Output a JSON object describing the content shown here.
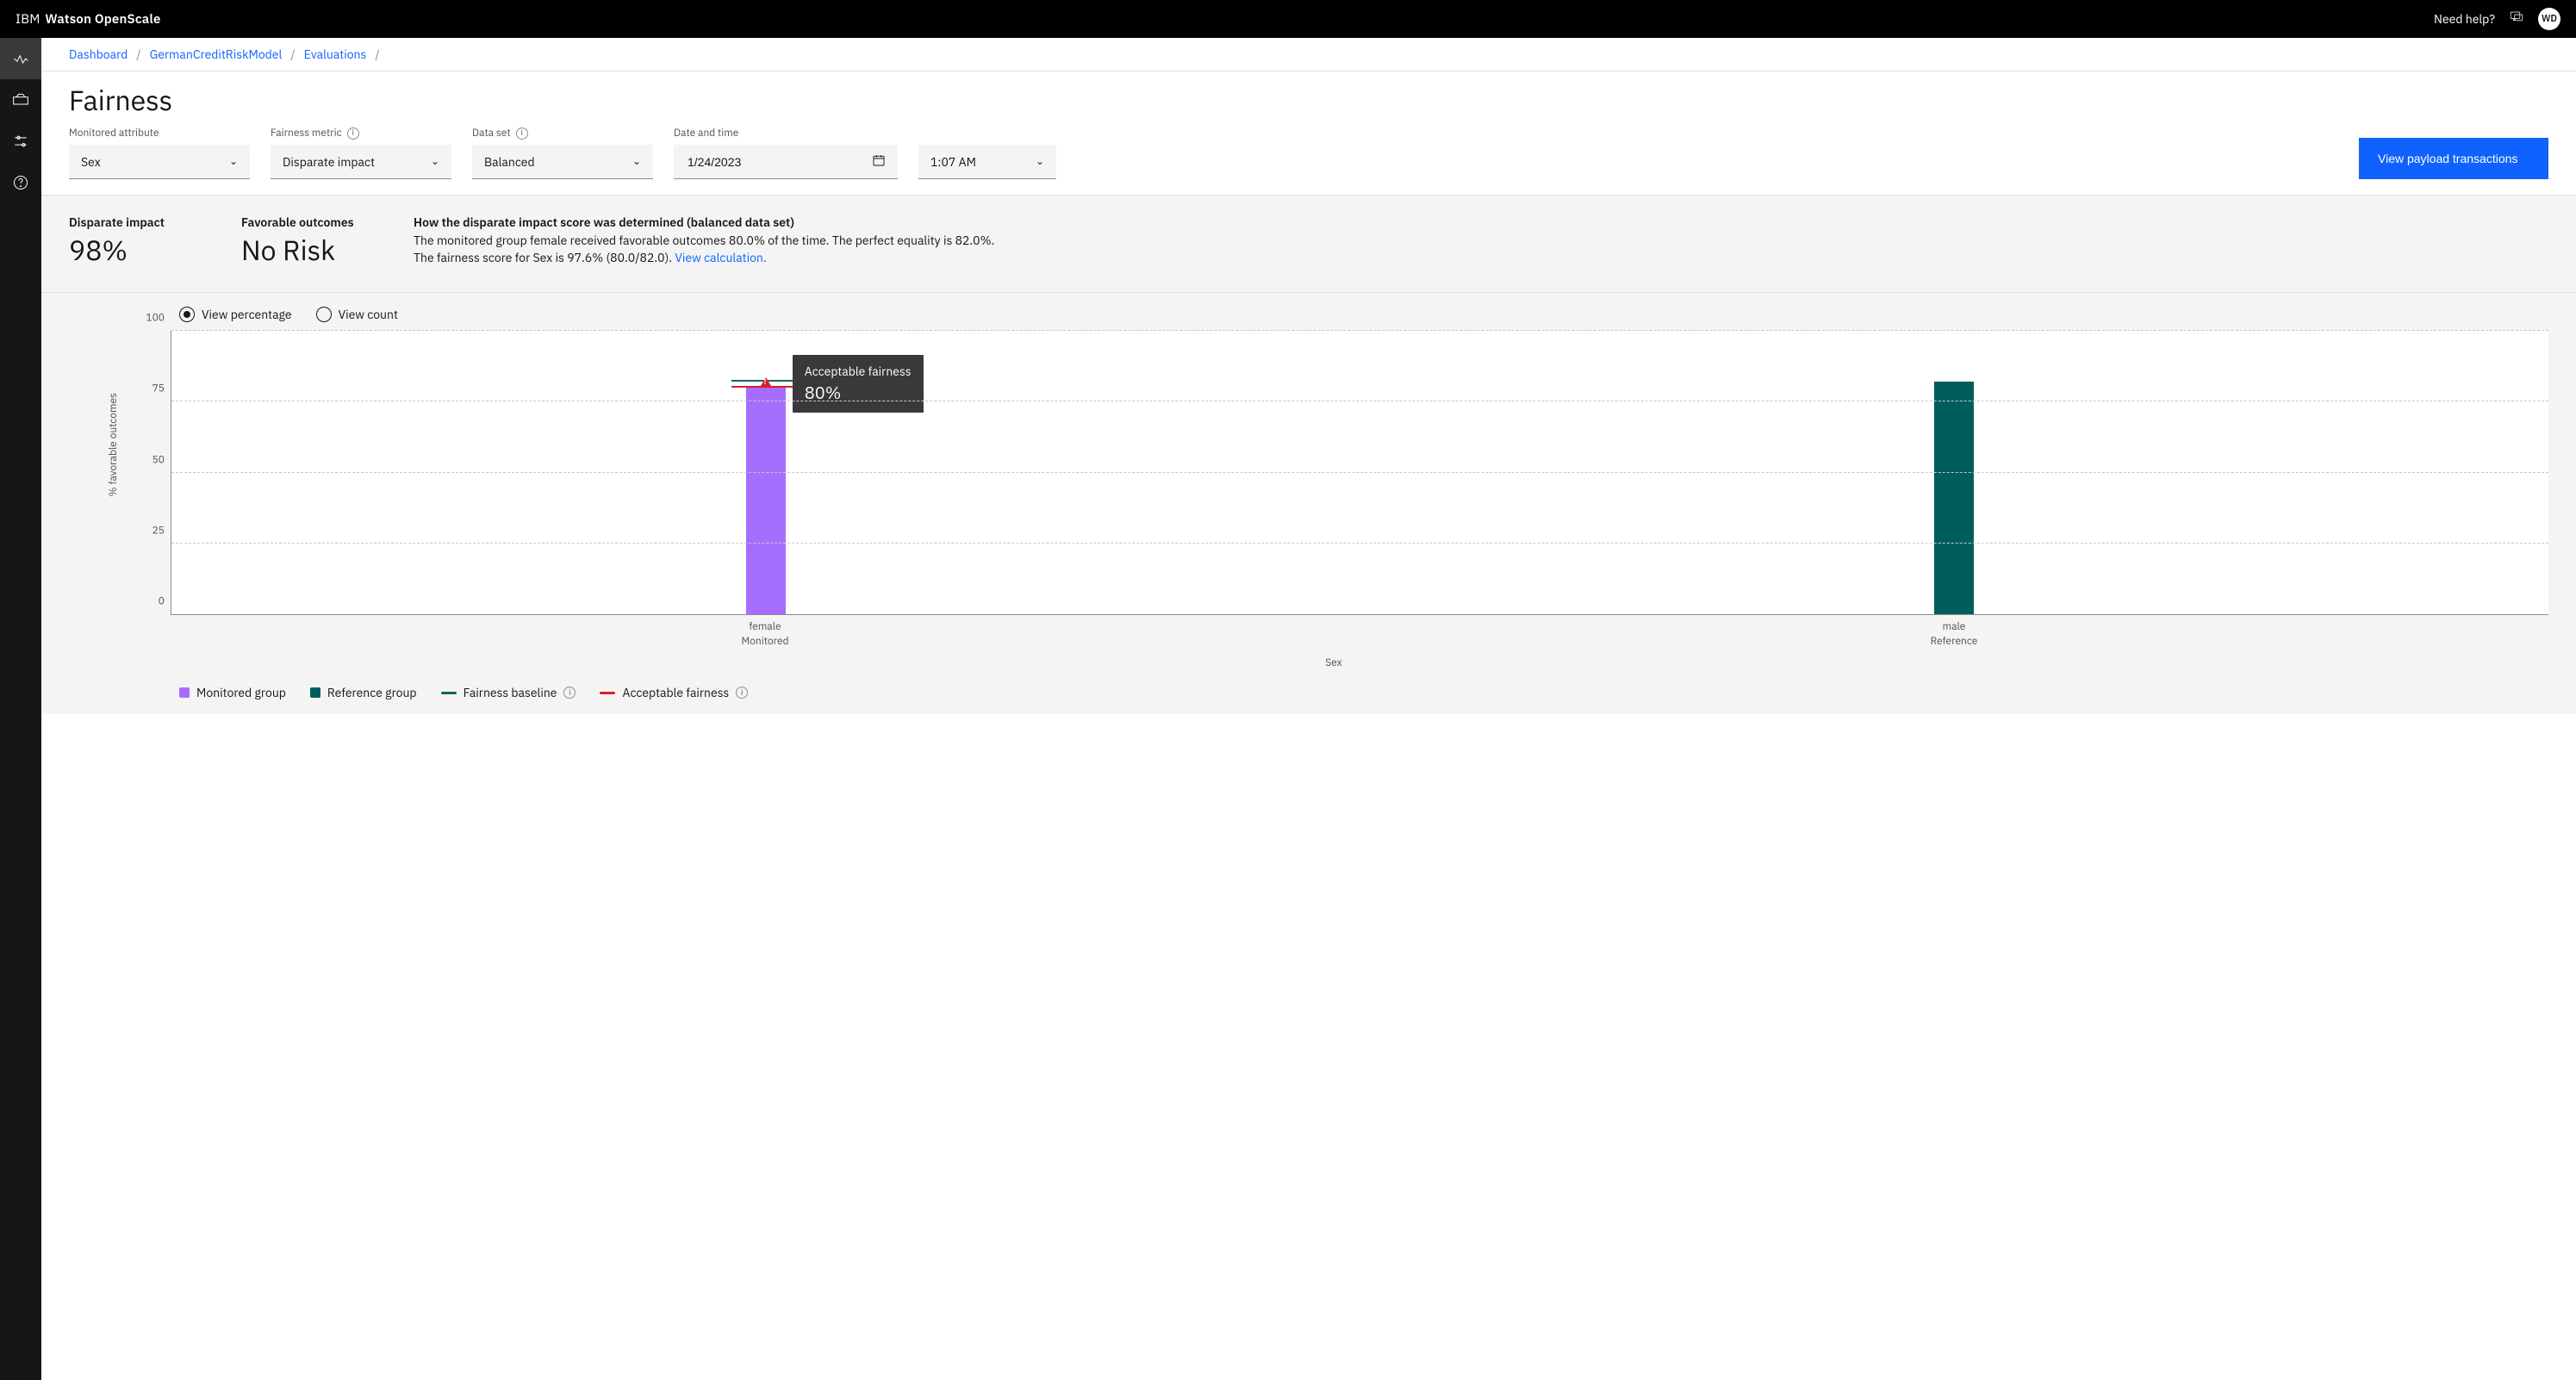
{
  "brand": {
    "light": "IBM",
    "bold": "Watson OpenScale"
  },
  "topbar": {
    "help": "Need help?",
    "avatar_initials": "WD"
  },
  "breadcrumb": {
    "items": [
      "Dashboard",
      "GermanCreditRiskModel",
      "Evaluations"
    ],
    "trailing_sep": "/"
  },
  "page": {
    "title": "Fairness"
  },
  "filters": {
    "monitored_attribute": {
      "label": "Monitored attribute",
      "value": "Sex"
    },
    "fairness_metric": {
      "label": "Fairness metric",
      "value": "Disparate impact"
    },
    "data_set": {
      "label": "Data set",
      "value": "Balanced"
    },
    "date": {
      "label": "Date and time",
      "value": "1/24/2023"
    },
    "time": {
      "value": "1:07 AM"
    },
    "view_transactions_btn": "View payload transactions"
  },
  "summary": {
    "di": {
      "label": "Disparate impact",
      "value": "98%"
    },
    "fav": {
      "label": "Favorable outcomes",
      "value": "No Risk"
    },
    "explain_title": "How the disparate impact score was determined (balanced data set)",
    "explain_body": "The monitored group female received favorable outcomes 80.0% of the time. The perfect equality is 82.0%. The fairness score for Sex is 97.6% (80.0/82.0).  ",
    "view_calc": "View calculation."
  },
  "view_toggle": {
    "percentage": "View percentage",
    "count": "View count",
    "selected": "percentage"
  },
  "legend": {
    "monitored": "Monitored group",
    "reference": "Reference group",
    "baseline": "Fairness baseline",
    "acceptable": "Acceptable fairness"
  },
  "tooltip": {
    "title": "Acceptable fairness",
    "value": "80%"
  },
  "chart_data": {
    "type": "bar",
    "title": "",
    "xlabel": "Sex",
    "ylabel": "% favorable outcomes",
    "ylim": [
      0,
      100
    ],
    "yticks": [
      0,
      25,
      50,
      75,
      100
    ],
    "categories": [
      "female",
      "male"
    ],
    "category_sublabels": [
      "Monitored",
      "Reference"
    ],
    "series": [
      {
        "name": "Monitored group",
        "color": "#a56eff",
        "values": [
          80,
          null
        ]
      },
      {
        "name": "Reference group",
        "color": "#005d5d",
        "values": [
          null,
          82
        ]
      }
    ],
    "fairness_baseline": 82,
    "acceptable_fairness": 80,
    "legend_position": "bottom",
    "grid": true
  }
}
